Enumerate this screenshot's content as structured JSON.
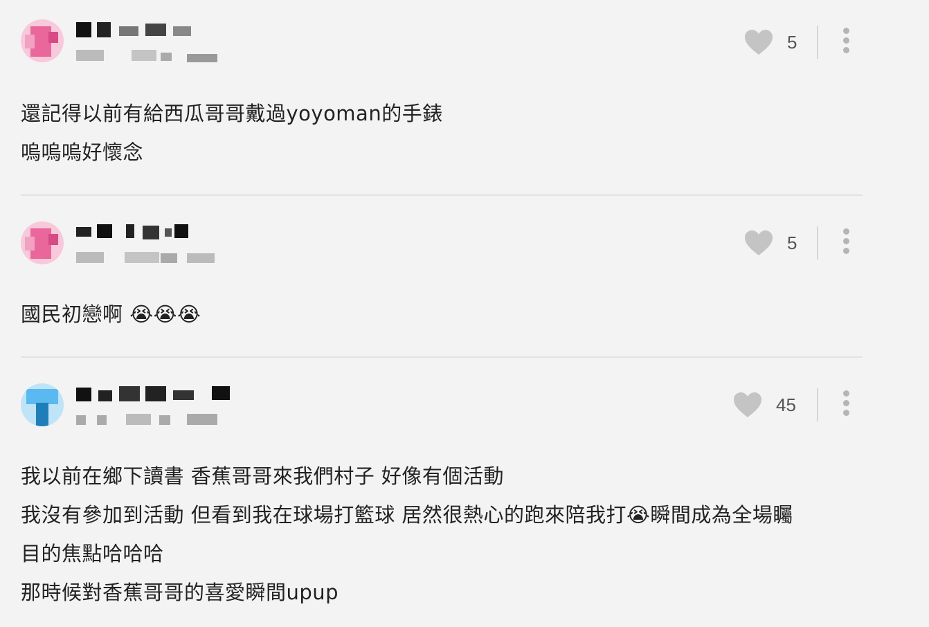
{
  "comments": [
    {
      "avatar_color": "#e9679b",
      "likes": "5",
      "lines": [
        "還記得以前有給西瓜哥哥戴過yoyoman的手錶",
        "嗚嗚嗚好懷念"
      ]
    },
    {
      "avatar_color": "#e9679b",
      "likes": "5",
      "lines": [
        "國民初戀啊 😭😭😭"
      ]
    },
    {
      "avatar_color": "#5ab9f0",
      "likes": "45",
      "lines": [
        "我以前在鄉下讀書 香蕉哥哥來我們村子 好像有個活動",
        "我沒有參加到活動 但看到我在球場打籃球 居然很熱心的跑來陪我打😭瞬間成為全場矚",
        "目的焦點哈哈哈",
        "那時候對香蕉哥哥的喜愛瞬間upup"
      ]
    }
  ],
  "icons": {
    "like": "heart-icon",
    "more": "more-vertical-icon"
  },
  "colors": {
    "background": "#f3f3f3",
    "icon_gray": "#c4c4c4",
    "divider": "#e2e2e2"
  }
}
